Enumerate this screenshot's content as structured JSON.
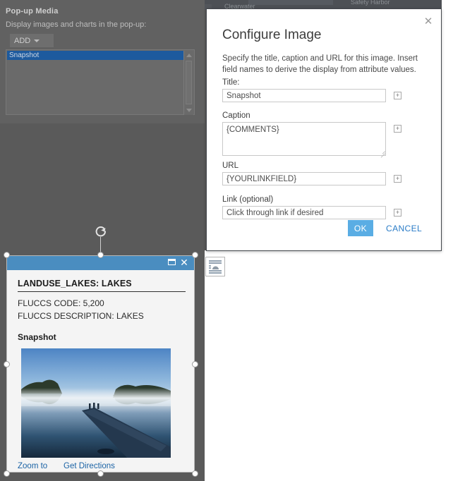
{
  "background": {
    "map_labels": [
      "Clearwater",
      "Safety Harbor"
    ],
    "canvas_color": "#5a5a5a"
  },
  "left_panel": {
    "title": "Pop-up Media",
    "subtitle": "Display images and charts in the pop-up:",
    "add_button": "ADD",
    "add_caret_icon": "chevron-down-icon",
    "media_items": [
      "Snapshot"
    ],
    "selected_item": "Snapshot",
    "scrollbar": {
      "up_icon": "caret-up-icon",
      "down_icon": "caret-down-icon"
    }
  },
  "modal": {
    "title": "Configure Image",
    "close_icon": "close-icon",
    "description": "Specify the title, caption and URL for this image. Insert field names to derive the display from attribute values.",
    "fields": [
      {
        "label": "Title:",
        "value": "Snapshot",
        "insert_icon": "plus-box-icon"
      },
      {
        "label": "Caption",
        "value": "{COMMENTS}",
        "insert_icon": "plus-box-icon"
      },
      {
        "label": "URL",
        "value": "{YOURLINKFIELD}",
        "insert_icon": "plus-box-icon"
      },
      {
        "label": "Link (optional)",
        "value": "Click through link if desired",
        "insert_icon": "plus-box-icon"
      }
    ],
    "ok_label": "OK",
    "cancel_label": "CANCEL",
    "ok_color": "#5aade4",
    "cancel_color": "#2a7cc7"
  },
  "canvas": {
    "media_placeholder_icon": "image-placeholder-icon",
    "rotate_icon": "rotate-handle-icon"
  },
  "popup": {
    "titlebar_color": "#4a8dc0",
    "maximize_icon": "maximize-icon",
    "close_icon": "close-icon",
    "heading": "LANDUSE_LAKES: LAKES",
    "attributes": [
      "FLUCCS CODE: 5,200",
      "FLUCCS DESCRIPTION: LAKES"
    ],
    "media_title": "Snapshot",
    "photo_alt": "misty lake with wooden dock at dawn",
    "links": [
      {
        "label": "Zoom to"
      },
      {
        "label": "Get Directions"
      }
    ]
  }
}
